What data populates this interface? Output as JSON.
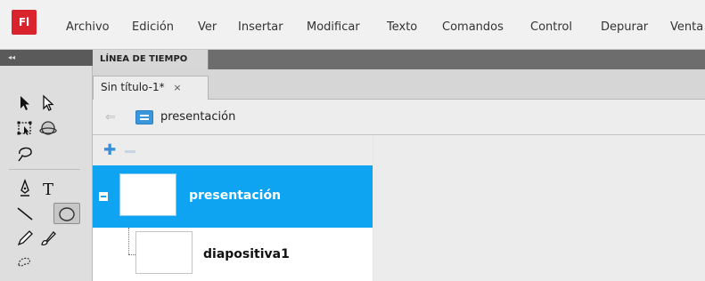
{
  "app": {
    "logo_text": "Fl",
    "menu": [
      "Archivo",
      "Edición",
      "Ver",
      "Insertar",
      "Modificar",
      "Texto",
      "Comandos",
      "Control",
      "Depurar",
      "Venta"
    ]
  },
  "tools": {
    "collapse_glyph": "◂◂",
    "items": [
      "selection-icon",
      "subselection-icon",
      "free-transform-icon",
      "3d-rotation-icon",
      "lasso-icon",
      "pen-icon",
      "text-icon",
      "line-icon",
      "oval-icon",
      "pencil-icon",
      "brush-icon",
      "deco-icon"
    ]
  },
  "timeline": {
    "tab_label": "LÍNEA DE TIEMPO"
  },
  "document": {
    "tab_label": "Sin título-1*",
    "close_glyph": "×"
  },
  "breadcrumb": {
    "back_glyph": "⇐",
    "label": "presentación"
  },
  "outline": {
    "add_glyph": "✚",
    "items": [
      {
        "label": "presentación",
        "selected": true
      },
      {
        "label": "diapositiva1",
        "selected": false
      }
    ]
  },
  "colors": {
    "selection": "#0ea4f1",
    "logo": "#d9232d",
    "accent": "#3b8fd6"
  }
}
